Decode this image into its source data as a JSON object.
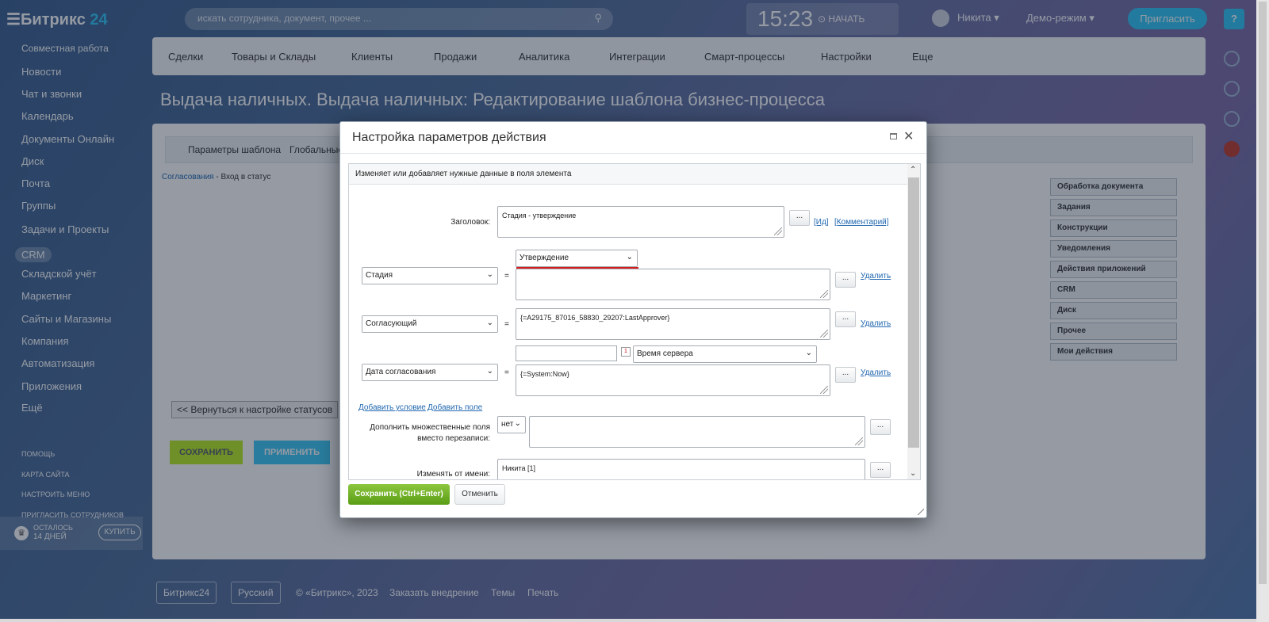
{
  "header": {
    "logo": "Битрикс",
    "logo_num": "24",
    "search_placeholder": "искать сотрудника, документ, прочее ...",
    "clock_time": "15:23",
    "clock_start": "⊙ НАЧАТЬ",
    "user_name": "Никита",
    "demo_mode": "Демо-режим",
    "invite": "Пригласить",
    "help": "?"
  },
  "left_menu": {
    "group": "Совместная работа",
    "items": [
      "Новости",
      "Чат и звонки",
      "Календарь",
      "Документы Онлайн",
      "Диск",
      "Почта",
      "Группы",
      "Задачи и Проекты",
      "CRM",
      "Складской учёт",
      "Маркетинг",
      "Сайты и Магазины",
      "Компания",
      "Автоматизация",
      "Приложения",
      "Ещё"
    ],
    "small_links": [
      "ПОМОЩЬ",
      "КАРТА САЙТА",
      "НАСТРОИТЬ МЕНЮ",
      "ПРИГЛАСИТЬ СОТРУДНИКОВ"
    ],
    "trial_line1": "ОСТАЛОСЬ",
    "trial_line2": "14 ДНЕЙ",
    "buy": "КУПИТЬ"
  },
  "top_nav": [
    "Сделки",
    "Товары и Склады",
    "Клиенты",
    "Продажи",
    "Аналитика",
    "Интеграции",
    "Смарт-процессы",
    "Настройки",
    "Еще"
  ],
  "page_title": "Выдача наличных. Выдача наличных: Редактирование шаблона бизнес-процесса",
  "content": {
    "tab1": "Параметры шаблона",
    "tab2": "Глобальные",
    "crumb_link": "Согласования",
    "crumb_rest": " - Вход в статус",
    "back": "<< Вернуться к настройке статусов",
    "save": "СОХРАНИТЬ",
    "apply": "ПРИМЕНИТЬ",
    "toolbox": [
      "Обработка документа",
      "Задания",
      "Конструкции",
      "Уведомления",
      "Действия приложений",
      "CRM",
      "Диск",
      "Прочее",
      "Мои действия"
    ]
  },
  "footer": {
    "brand": "Битрикс24",
    "lang": "Русский",
    "copy": "© «Битрикс», 2023",
    "order": "Заказать внедрение",
    "themes": "Темы",
    "print": "Печать"
  },
  "dialog": {
    "title": "Настройка параметров действия",
    "description": "Изменяет или добавляет нужные данные в поля элемента",
    "title_label": "Заголовок:",
    "title_value": "Стадия - утверждение",
    "link_id": "[Ид]",
    "link_comment": "[Комментарий]",
    "dots": "...",
    "eq": "=",
    "delete": "Удалить",
    "row1_field": "Стадия",
    "row1_value_select": "Утверждение",
    "row1_value": "",
    "row2_field": "Согласующий",
    "row2_value": "{=A29175_87016_58830_29207:LastApprover}",
    "row3_field": "Дата согласования",
    "row3_tz": "Время сервера",
    "row3_value": "{=System:Now}",
    "add_condition": "Добавить условие",
    "add_field": "Добавить поле",
    "append_label": "Дополнить множественные поля вместо перезаписи:",
    "append_value": "нет",
    "on_behalf_label": "Изменять от имени:",
    "on_behalf_value": "Никита [1]",
    "ok": "Сохранить (Ctrl+Enter)",
    "cancel": "Отменить"
  },
  "colors": {
    "accent": "#2fc6f6",
    "save_green": "#bbed21",
    "dialog_ok": "#6fae26",
    "highlight_red": "#d61e1e"
  }
}
